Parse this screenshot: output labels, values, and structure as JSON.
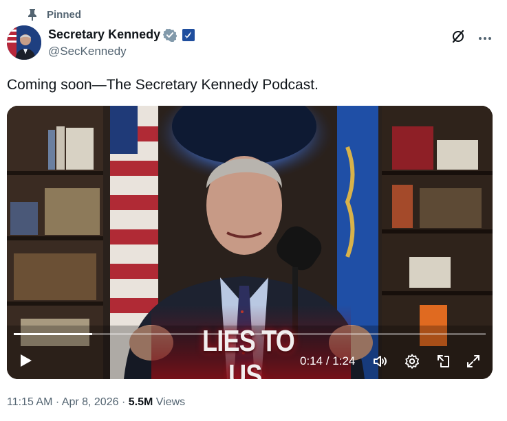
{
  "pinned": {
    "label": "Pinned",
    "icon": "pin-icon"
  },
  "author": {
    "display_name": "Secretary Kennedy",
    "handle": "@SecKennedy",
    "verified_color": "#829aab",
    "affiliate_badge": "hhs-badge"
  },
  "post": {
    "text": "Coming soon—The Secretary Kennedy Podcast."
  },
  "video": {
    "caption": "LIES TO US.",
    "time_current": "0:14",
    "time_sep": " / ",
    "time_total": "1:24",
    "progress_fraction": 0.1667
  },
  "meta": {
    "time": "11:15 AM",
    "date": "Apr 8, 2026",
    "views_count": "5.5M",
    "views_label": "Views",
    "dot": "·"
  },
  "colors": {
    "secondary_text": "#536471",
    "primary_text": "#0f1419",
    "accent": "#1d9bf0"
  }
}
